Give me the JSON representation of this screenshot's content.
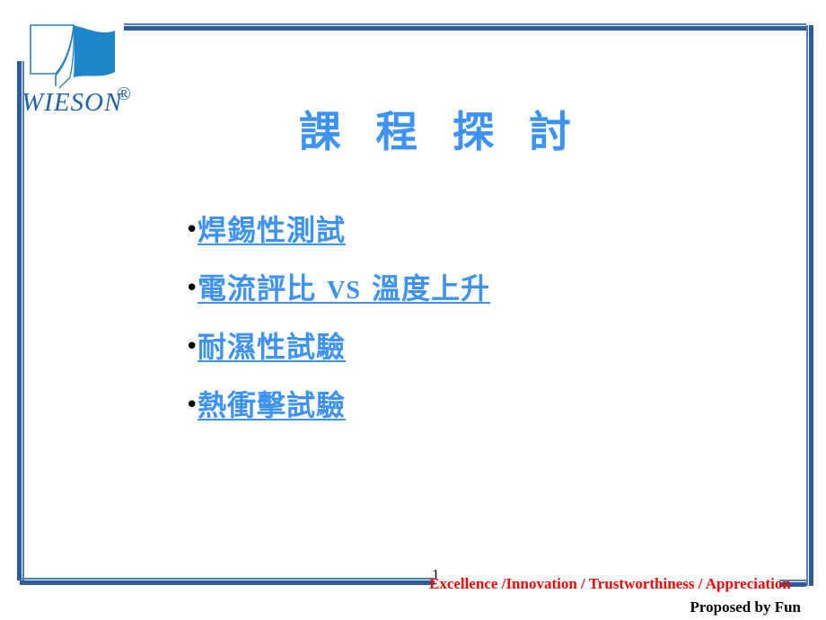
{
  "slide": {
    "title": "課 程 探 討",
    "page_number": "1"
  },
  "logo": {
    "icon": "wieson-flag-logo",
    "wordmark": "WIESON",
    "registered_mark": "®",
    "brand_color": "#1f63ad"
  },
  "bullets": [
    {
      "marker": "•",
      "label": "焊錫性測試"
    },
    {
      "marker": "•",
      "label_pre": "電流評比 ",
      "label_latin": "VS",
      "label_post": " 溫度上升"
    },
    {
      "marker": "•",
      "label": "耐濕性試驗"
    },
    {
      "marker": "•",
      "label": "熱衝擊試驗"
    }
  ],
  "footer": {
    "slogan": "Excellence /Innovation / Trustworthiness / Appreciation",
    "slogan_color": "#ff0000",
    "author": "Proposed  by Fun"
  },
  "frame": {
    "accent_dark": "#2d5ba0",
    "accent_light": "#4f7fbf"
  },
  "theme": {
    "title_color": "#3d93f5",
    "link_color": "#3d93f5",
    "background": "#ffffff"
  }
}
